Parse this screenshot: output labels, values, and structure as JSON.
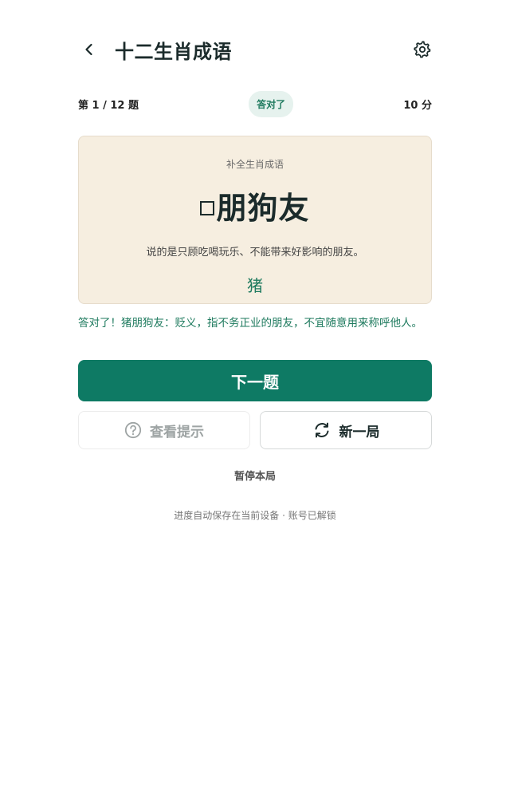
{
  "header": {
    "title": "十二生肖成语",
    "back_icon": "chevron-left-icon",
    "settings_icon": "gear-icon"
  },
  "status": {
    "progress": "第 1 / 12 题",
    "badge": "答对了",
    "score": "10 分"
  },
  "card": {
    "label": "补全生肖成语",
    "idiom_rest": "朋狗友",
    "description": "说的是只顾吃喝玩乐、不能带来好影响的朋友。",
    "answer": "猪"
  },
  "feedback": "答对了！猪朋狗友：贬义，指不务正业的朋友，不宜随意用来称呼他人。",
  "buttons": {
    "next": "下一题",
    "hint": "查看提示",
    "hint_icon": "question-circle-icon",
    "new_game": "新一局",
    "new_game_icon": "refresh-icon",
    "pause": "暂停本局"
  },
  "footer": "进度自动保存在当前设备 · 账号已解锁",
  "colors": {
    "accent": "#0e7a64",
    "success_text": "#1e7a5e",
    "card_bg": "#f6eee0",
    "badge_bg": "#e6f2ee"
  }
}
